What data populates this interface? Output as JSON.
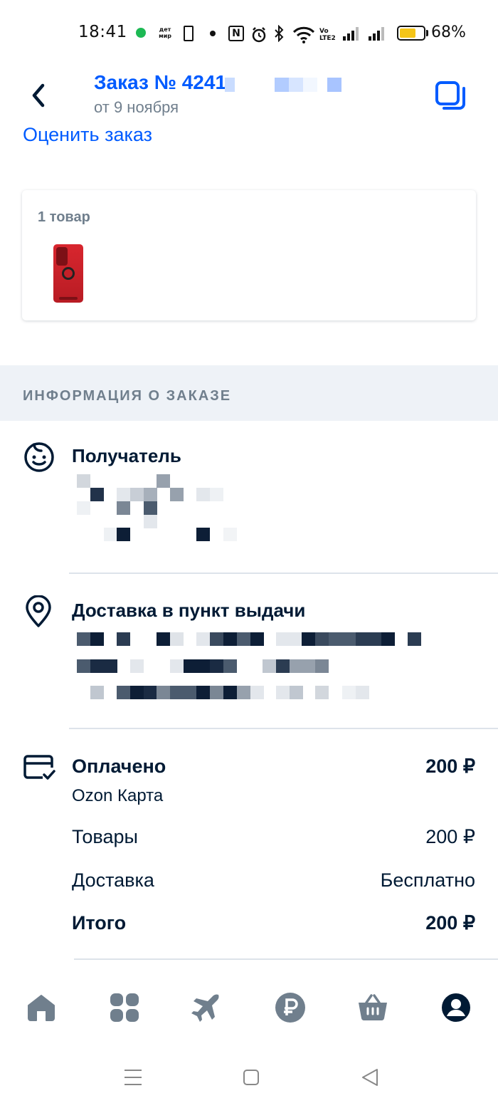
{
  "status_bar": {
    "time": "18:41",
    "detmir_label": "дет мир",
    "nfc_label": "N",
    "volte_label": "Vo LTE2",
    "battery_percent": "68%",
    "battery_level": 0.68
  },
  "header": {
    "title": "Заказ № 4241",
    "date": "от 9 ноября",
    "rate_link": "Оценить заказ"
  },
  "items": {
    "count_label": "1 товар",
    "thumbnail": "red-phone-case"
  },
  "order_info": {
    "section_title": "ИНФОРМАЦИЯ О ЗАКАЗЕ",
    "recipient_title": "Получатель",
    "delivery_title": "Доставка в пункт выдачи"
  },
  "payment": {
    "status": "Оплачено",
    "paid_amount": "200 ₽",
    "method": "Ozon Карта",
    "goods_label": "Товары",
    "goods_value": "200 ₽",
    "delivery_label": "Доставка",
    "delivery_value": "Бесплатно",
    "total_label": "Итого",
    "total_value": "200 ₽"
  },
  "bottom_nav": {
    "items": [
      "home-icon",
      "catalog-icon",
      "travel-icon",
      "finance-icon",
      "cart-icon",
      "profile-icon"
    ],
    "active": "profile-icon"
  },
  "colors": {
    "accent": "#005bff",
    "text": "#001a34",
    "muted": "#707f8d",
    "band": "#eef2f7",
    "nav_icon": "#707f8d"
  }
}
